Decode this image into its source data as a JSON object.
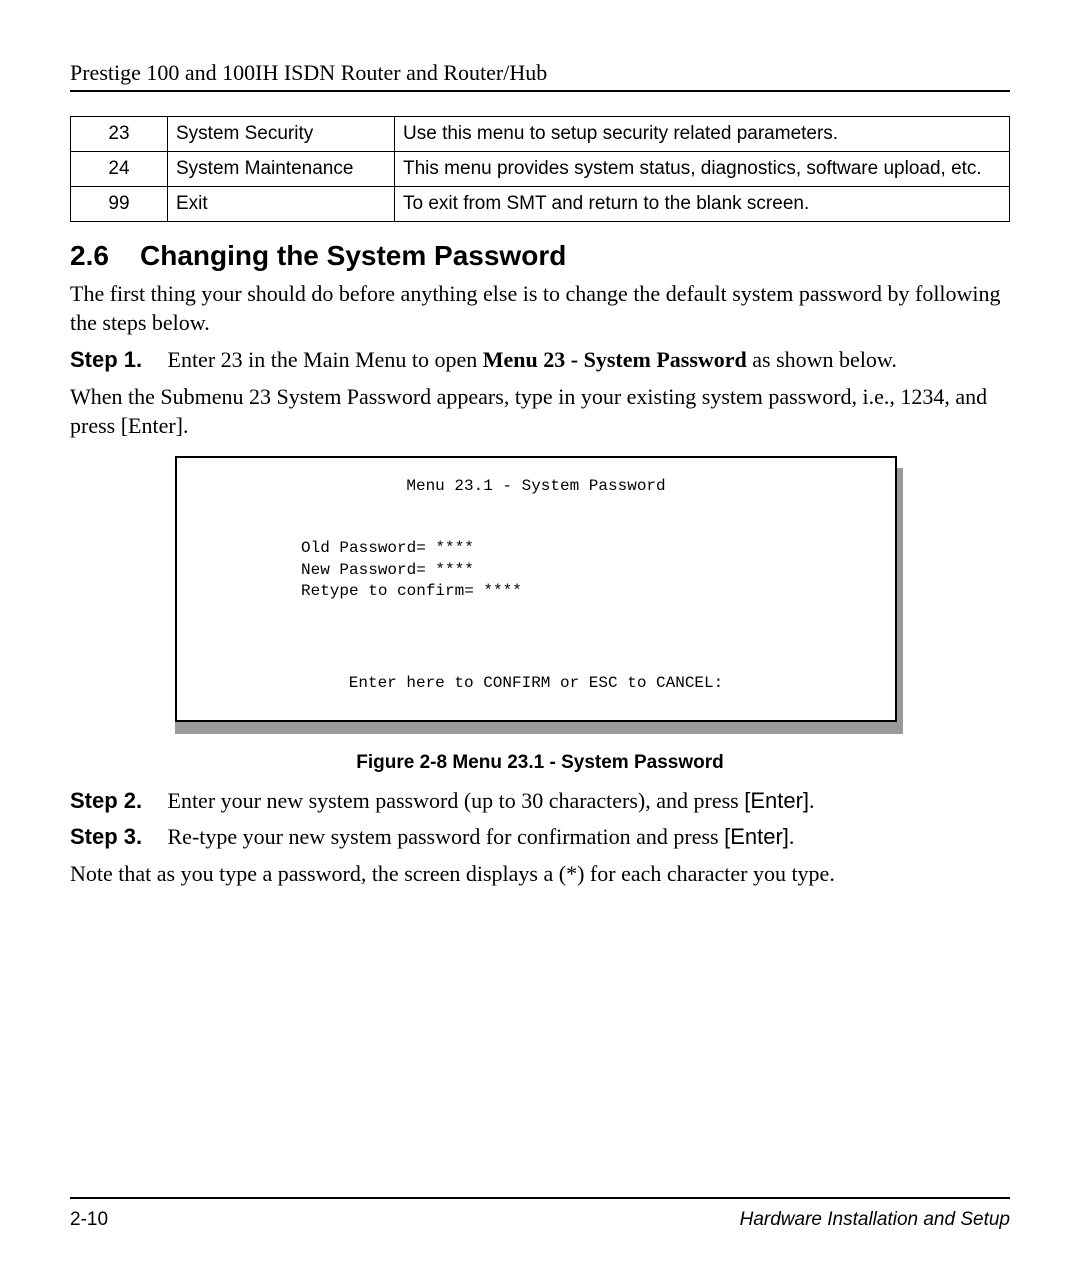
{
  "header": {
    "title": "Prestige 100 and 100IH ISDN Router and Router/Hub"
  },
  "table": {
    "rows": [
      {
        "num": "23",
        "name": "System Security",
        "desc": "Use this menu to setup security related parameters."
      },
      {
        "num": "24",
        "name": "System Maintenance",
        "desc": "This menu provides system status, diagnostics, software upload, etc."
      },
      {
        "num": "99",
        "name": "Exit",
        "desc": "To exit from SMT and return to the blank screen."
      }
    ]
  },
  "section": {
    "number": "2.6",
    "title": "Changing the System Password",
    "intro": "The first thing your should do before anything else is to change the default system password by following the steps below.",
    "step1_label": "Step 1.",
    "step1_text_a": "Enter 23 in the Main Menu to open ",
    "step1_bold": "Menu 23 - System Password",
    "step1_text_b": " as shown below.",
    "submenu_text": "When the Submenu 23 System Password appears, type in your existing system password, i.e., 1234, and press [Enter].",
    "terminal": {
      "title": "Menu 23.1 - System Password",
      "line1": "Old Password= ****",
      "line2": "New Password= ****",
      "line3": "Retype to confirm= ****",
      "footer": "Enter here to CONFIRM or ESC to CANCEL:"
    },
    "figure_caption": "Figure 2-8 Menu 23.1 - System Password",
    "step2_label": "Step 2.",
    "step2_text_a": "Enter your new system password (up to 30 characters), and press ",
    "step2_enter": "[Enter]",
    "step2_text_b": ".",
    "step3_label": "Step 3.",
    "step3_text_a": "Re-type your new system password for confirmation and press ",
    "step3_enter": "[Enter]",
    "step3_text_b": ".",
    "note": "Note that as you type a password, the screen displays a (*) for each character you type."
  },
  "footer": {
    "page": "2-10",
    "section": "Hardware Installation and Setup"
  }
}
